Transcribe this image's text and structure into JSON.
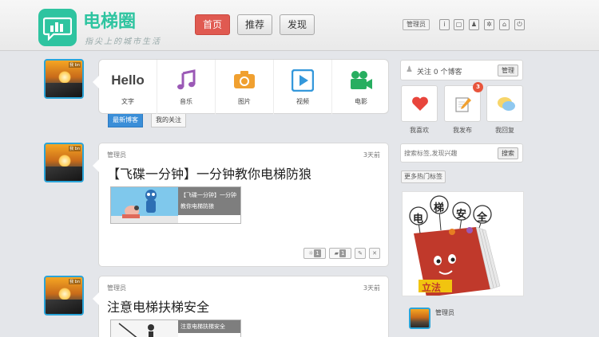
{
  "header": {
    "logo_title": "电梯圈",
    "slogan": "指尖上的城市生活",
    "nav": [
      "首页",
      "推荐",
      "发现"
    ],
    "user_label": "管理员",
    "icons": [
      "info-icon",
      "message-icon",
      "user-add-icon",
      "gear-icon",
      "home-icon",
      "power-icon"
    ]
  },
  "publish": {
    "items": [
      {
        "label": "文字",
        "icon": "hello-text"
      },
      {
        "label": "音乐",
        "icon": "music-icon"
      },
      {
        "label": "图片",
        "icon": "camera-icon"
      },
      {
        "label": "视频",
        "icon": "video-icon"
      },
      {
        "label": "电影",
        "icon": "movie-camera-icon"
      }
    ],
    "hello": "Hello",
    "tabs": [
      "最新博客",
      "我的关注"
    ]
  },
  "feed": [
    {
      "author": "管理员",
      "time": "3天前",
      "title": "【飞碟一分钟】一分钟教你电梯防狼",
      "caption": "【飞碟一分钟】一分钟教你电梯防狼",
      "like_count": "1",
      "comment_count": "1"
    },
    {
      "author": "管理员",
      "time": "3天前",
      "title": "注意电梯扶梯安全",
      "caption": "注意电梯扶梯安全"
    }
  ],
  "sidebar": {
    "follow_text": "关注 0 个博客",
    "manage_button": "管理",
    "tiles": [
      {
        "label": "我喜欢",
        "icon": "heart-icon"
      },
      {
        "label": "我发布",
        "icon": "edit-icon"
      },
      {
        "label": "我回复",
        "icon": "chat-icon"
      }
    ],
    "publish_badge": "3",
    "search_placeholder": "搜索标签,发现兴趣",
    "search_button": "搜索",
    "more_tags": "更多热门标签",
    "image_words": [
      "电",
      "梯",
      "安",
      "全",
      "立法"
    ],
    "user_name": "管理员",
    "avatar_tag": "我 bn"
  },
  "colors": {
    "brand": "#2ec4a0",
    "nav_active": "#e05a51",
    "tab_active": "#3a8ed8",
    "avatar_border": "#2aa4d8"
  }
}
